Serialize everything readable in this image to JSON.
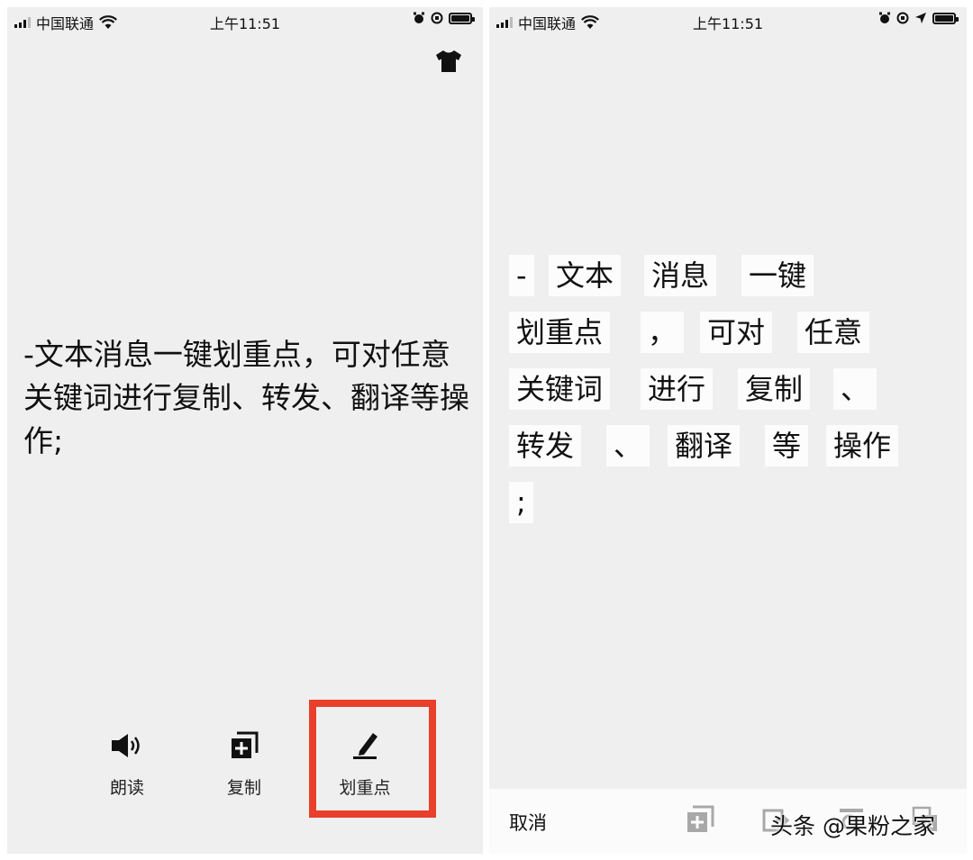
{
  "left_screen": {
    "status": {
      "carrier": "中国联通",
      "time": "上午11:51"
    },
    "message": "-文本消息一键划重点，可对任意关键词进行复制、转发、翻译等操作;",
    "toolbar": {
      "read_label": "朗读",
      "copy_label": "复制",
      "mark_label": "划重点"
    }
  },
  "right_screen": {
    "status": {
      "carrier": "中国联通",
      "time": "上午11:51"
    },
    "token_rows": [
      [
        "-",
        "文本",
        "消息",
        "一键"
      ],
      [
        "划重点",
        "，",
        "可对",
        "任意"
      ],
      [
        "关键词",
        "进行",
        "复制",
        "、"
      ],
      [
        "转发",
        "、",
        "翻译",
        "等",
        "操作"
      ],
      [
        ";"
      ]
    ],
    "bottom": {
      "cancel_label": "取消"
    }
  },
  "watermark": "头条 @果粉之家",
  "colors": {
    "highlight": "#e8402a",
    "background": "#efefef"
  }
}
